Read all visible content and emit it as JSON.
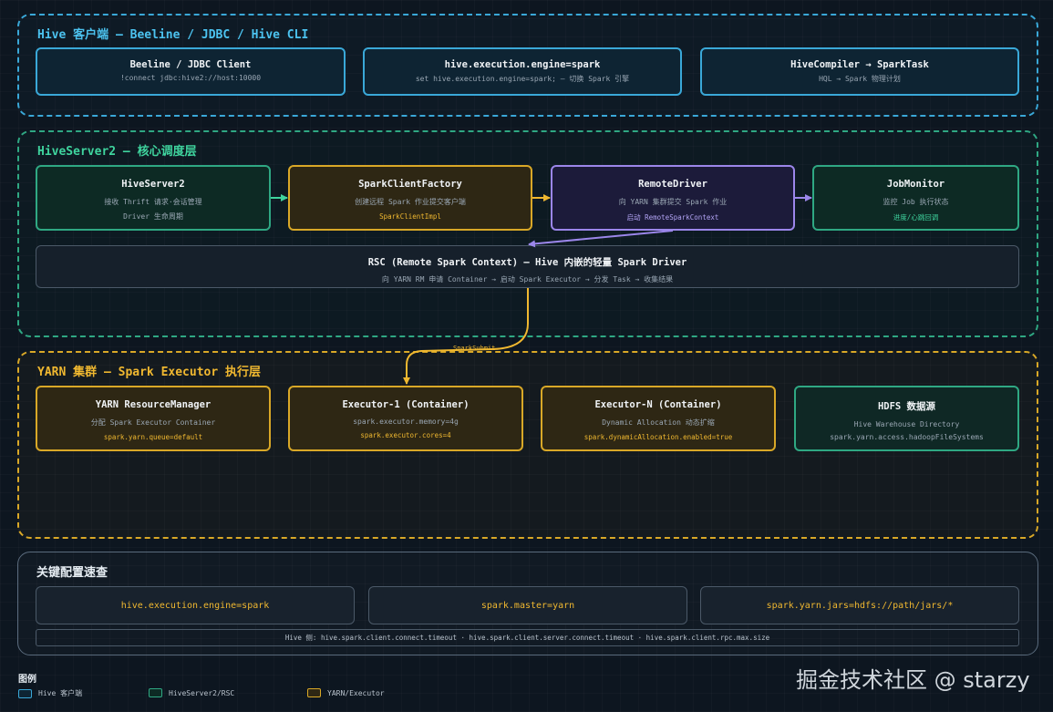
{
  "sections": {
    "client": {
      "title": "Hive 客户端 — Beeline / JDBC / Hive CLI",
      "boxes": [
        {
          "title": "Beeline / JDBC Client",
          "sub": "!connect jdbc:hive2://host:10000"
        },
        {
          "title": "hive.execution.engine=spark",
          "sub": "set hive.execution.engine=spark; — 切换 Spark 引擎"
        },
        {
          "title": "HiveCompiler → SparkTask",
          "sub": "HQL → Spark 物理计划"
        }
      ]
    },
    "hs2": {
      "title": "HiveServer2 — 核心调度层",
      "boxes": [
        {
          "title": "HiveServer2",
          "sub1": "接收 Thrift 请求·会话管理",
          "sub2": "Driver 生命周期"
        },
        {
          "title": "SparkClientFactory",
          "sub": "创建远程 Spark 作业提交客户端",
          "highlight": "SparkClientImpl"
        },
        {
          "title": "RemoteDriver",
          "sub": "向 YARN 集群提交 Spark 作业",
          "highlight": "启动 RemoteSparkContext"
        },
        {
          "title": "JobMonitor",
          "sub": "监控 Job 执行状态",
          "highlight": "进度/心跳回调"
        }
      ],
      "rsc": {
        "title": "RSC (Remote Spark Context) — Hive 内嵌的轻量 Spark Driver",
        "sub": "向 YARN RM 申请 Container → 启动 Spark Executor → 分发 Task → 收集结果"
      }
    },
    "yarn": {
      "title": "YARN 集群 — Spark Executor 执行层",
      "arrow_label": "SparkSubmit",
      "boxes": [
        {
          "title": "YARN ResourceManager",
          "sub": "分配 Spark Executor Container",
          "highlight": "spark.yarn.queue=default"
        },
        {
          "title": "Executor-1 (Container)",
          "sub": "spark.executor.memory=4g",
          "highlight": "spark.executor.cores=4"
        },
        {
          "title": "Executor-N (Container)",
          "sub": "Dynamic Allocation 动态扩缩",
          "highlight": "spark.dynamicAllocation.enabled=true"
        },
        {
          "title": "HDFS 数据源",
          "sub1": "Hive Warehouse Directory",
          "sub2": "spark.yarn.access.hadoopFileSystems"
        }
      ]
    },
    "config": {
      "title": "关键配置速查",
      "items": [
        "hive.execution.engine=spark",
        "spark.master=yarn",
        "spark.yarn.jars=hdfs://path/jars/*"
      ],
      "note": "Hive 侧: hive.spark.client.connect.timeout · hive.spark.client.server.connect.timeout · hive.spark.client.rpc.max.size"
    }
  },
  "legend": {
    "title": "图例",
    "items": [
      {
        "label": "Hive 客户端",
        "color": "#3aa8d8"
      },
      {
        "label": "HiveServer2/RSC",
        "color": "#2fa883"
      },
      {
        "label": "YARN/Executor",
        "color": "#d9a827"
      }
    ]
  },
  "watermark": "掘金技术社区 @ starzy",
  "colors": {
    "client": "#3aa8d8",
    "hs2": "#2fa883",
    "yarn": "#d9a827",
    "remote_driver": "#9b86ea",
    "background": "#0d1620"
  }
}
